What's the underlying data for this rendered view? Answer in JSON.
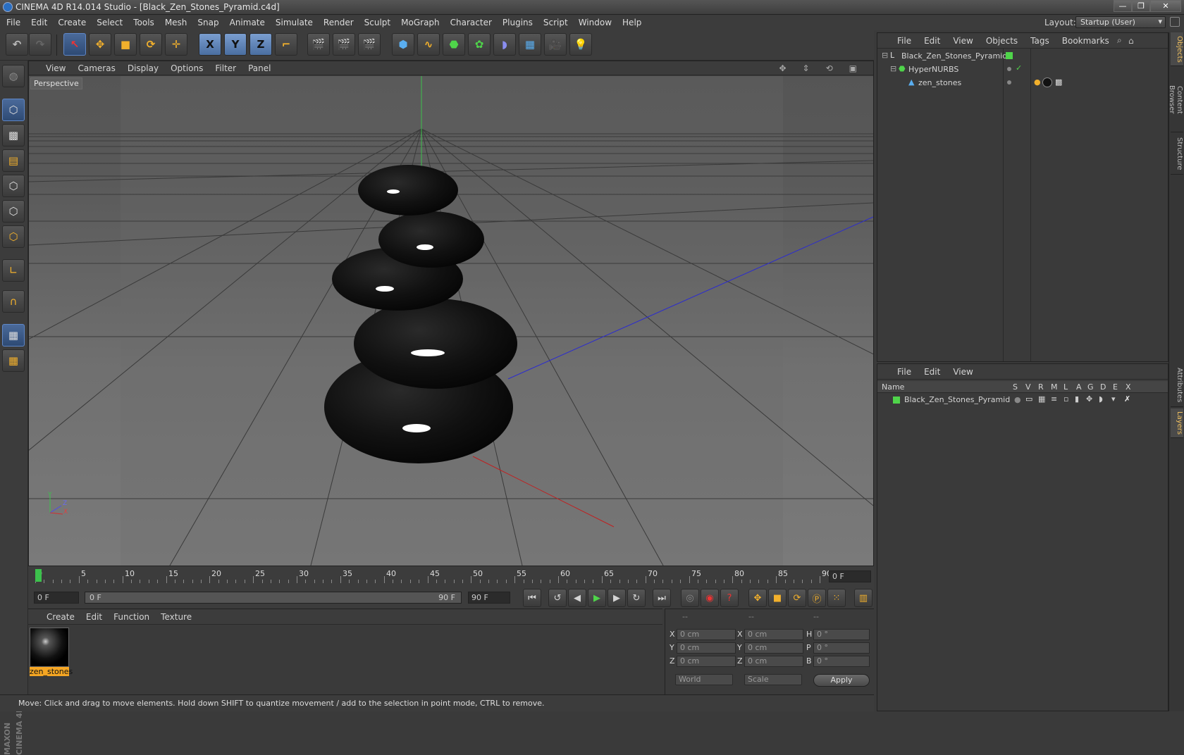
{
  "window": {
    "title": "CINEMA 4D R14.014 Studio - [Black_Zen_Stones_Pyramid.c4d]",
    "minimize": "—",
    "maximize": "❐",
    "close": "✕"
  },
  "menubar": [
    "File",
    "Edit",
    "Create",
    "Select",
    "Tools",
    "Mesh",
    "Snap",
    "Animate",
    "Simulate",
    "Render",
    "Sculpt",
    "MoGraph",
    "Character",
    "Plugins",
    "Script",
    "Window",
    "Help"
  ],
  "layout": {
    "label": "Layout:",
    "value": "Startup (User)"
  },
  "toolbar_axis": {
    "x": "X",
    "y": "Y",
    "z": "Z"
  },
  "viewport": {
    "menu": [
      "View",
      "Cameras",
      "Display",
      "Options",
      "Filter",
      "Panel"
    ],
    "label": "Perspective",
    "axis": {
      "y": "Y",
      "z": "Z",
      "x": "X"
    }
  },
  "timeline": {
    "ticks": [
      "0",
      "5",
      "10",
      "15",
      "20",
      "25",
      "30",
      "35",
      "40",
      "45",
      "50",
      "55",
      "60",
      "65",
      "70",
      "75",
      "80",
      "85",
      "90"
    ],
    "current_frame": "0 F",
    "start_field": "0 F",
    "slider_start": "0 F",
    "slider_end": "90 F",
    "end_field": "90 F"
  },
  "material_panel": {
    "menu": [
      "Create",
      "Edit",
      "Function",
      "Texture"
    ],
    "material_name": "zen_stones"
  },
  "coords": {
    "headers": [
      "--",
      "--",
      "--"
    ],
    "rows": [
      {
        "a": "X",
        "pos": "0 cm",
        "b": "X",
        "size": "0 cm",
        "c": "H",
        "rot": "0 °"
      },
      {
        "a": "Y",
        "pos": "0 cm",
        "b": "Y",
        "size": "0 cm",
        "c": "P",
        "rot": "0 °"
      },
      {
        "a": "Z",
        "pos": "0 cm",
        "b": "Z",
        "size": "0 cm",
        "c": "B",
        "rot": "0 °"
      }
    ],
    "mode1": "World",
    "mode2": "Scale",
    "apply": "Apply"
  },
  "status": "Move: Click and drag to move elements. Hold down SHIFT to quantize movement / add to the selection in point mode, CTRL to remove.",
  "objects_panel": {
    "menu": [
      "File",
      "Edit",
      "View",
      "Objects",
      "Tags",
      "Bookmarks"
    ],
    "items": [
      {
        "name": "Black_Zen_Stones_Pyramid"
      },
      {
        "name": "HyperNURBS"
      },
      {
        "name": "zen_stones"
      }
    ]
  },
  "layers_panel": {
    "menu": [
      "File",
      "Edit",
      "View"
    ],
    "header": "Name",
    "cols": [
      "S",
      "V",
      "R",
      "M",
      "L",
      "A",
      "G",
      "D",
      "E",
      "X"
    ],
    "layer_name": "Black_Zen_Stones_Pyramid"
  },
  "side_tabs": [
    "Objects",
    "Content Browser",
    "Structure",
    "Attributes",
    "Layers"
  ],
  "branding": "MAXON CINEMA 4D",
  "colors": {
    "accent": "#5f87c7",
    "layer_color": "#4fd44a",
    "material_highlight": "#f5a623"
  }
}
